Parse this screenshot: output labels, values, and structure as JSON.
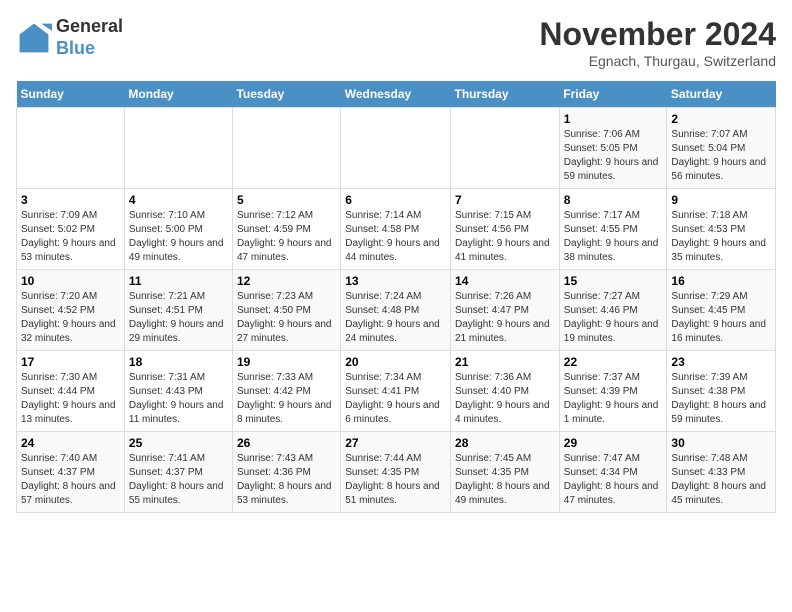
{
  "logo": {
    "text_general": "General",
    "text_blue": "Blue"
  },
  "title": "November 2024",
  "subtitle": "Egnach, Thurgau, Switzerland",
  "days_of_week": [
    "Sunday",
    "Monday",
    "Tuesday",
    "Wednesday",
    "Thursday",
    "Friday",
    "Saturday"
  ],
  "weeks": [
    [
      {
        "day": "",
        "info": ""
      },
      {
        "day": "",
        "info": ""
      },
      {
        "day": "",
        "info": ""
      },
      {
        "day": "",
        "info": ""
      },
      {
        "day": "",
        "info": ""
      },
      {
        "day": "1",
        "info": "Sunrise: 7:06 AM\nSunset: 5:05 PM\nDaylight: 9 hours and 59 minutes."
      },
      {
        "day": "2",
        "info": "Sunrise: 7:07 AM\nSunset: 5:04 PM\nDaylight: 9 hours and 56 minutes."
      }
    ],
    [
      {
        "day": "3",
        "info": "Sunrise: 7:09 AM\nSunset: 5:02 PM\nDaylight: 9 hours and 53 minutes."
      },
      {
        "day": "4",
        "info": "Sunrise: 7:10 AM\nSunset: 5:00 PM\nDaylight: 9 hours and 49 minutes."
      },
      {
        "day": "5",
        "info": "Sunrise: 7:12 AM\nSunset: 4:59 PM\nDaylight: 9 hours and 47 minutes."
      },
      {
        "day": "6",
        "info": "Sunrise: 7:14 AM\nSunset: 4:58 PM\nDaylight: 9 hours and 44 minutes."
      },
      {
        "day": "7",
        "info": "Sunrise: 7:15 AM\nSunset: 4:56 PM\nDaylight: 9 hours and 41 minutes."
      },
      {
        "day": "8",
        "info": "Sunrise: 7:17 AM\nSunset: 4:55 PM\nDaylight: 9 hours and 38 minutes."
      },
      {
        "day": "9",
        "info": "Sunrise: 7:18 AM\nSunset: 4:53 PM\nDaylight: 9 hours and 35 minutes."
      }
    ],
    [
      {
        "day": "10",
        "info": "Sunrise: 7:20 AM\nSunset: 4:52 PM\nDaylight: 9 hours and 32 minutes."
      },
      {
        "day": "11",
        "info": "Sunrise: 7:21 AM\nSunset: 4:51 PM\nDaylight: 9 hours and 29 minutes."
      },
      {
        "day": "12",
        "info": "Sunrise: 7:23 AM\nSunset: 4:50 PM\nDaylight: 9 hours and 27 minutes."
      },
      {
        "day": "13",
        "info": "Sunrise: 7:24 AM\nSunset: 4:48 PM\nDaylight: 9 hours and 24 minutes."
      },
      {
        "day": "14",
        "info": "Sunrise: 7:26 AM\nSunset: 4:47 PM\nDaylight: 9 hours and 21 minutes."
      },
      {
        "day": "15",
        "info": "Sunrise: 7:27 AM\nSunset: 4:46 PM\nDaylight: 9 hours and 19 minutes."
      },
      {
        "day": "16",
        "info": "Sunrise: 7:29 AM\nSunset: 4:45 PM\nDaylight: 9 hours and 16 minutes."
      }
    ],
    [
      {
        "day": "17",
        "info": "Sunrise: 7:30 AM\nSunset: 4:44 PM\nDaylight: 9 hours and 13 minutes."
      },
      {
        "day": "18",
        "info": "Sunrise: 7:31 AM\nSunset: 4:43 PM\nDaylight: 9 hours and 11 minutes."
      },
      {
        "day": "19",
        "info": "Sunrise: 7:33 AM\nSunset: 4:42 PM\nDaylight: 9 hours and 8 minutes."
      },
      {
        "day": "20",
        "info": "Sunrise: 7:34 AM\nSunset: 4:41 PM\nDaylight: 9 hours and 6 minutes."
      },
      {
        "day": "21",
        "info": "Sunrise: 7:36 AM\nSunset: 4:40 PM\nDaylight: 9 hours and 4 minutes."
      },
      {
        "day": "22",
        "info": "Sunrise: 7:37 AM\nSunset: 4:39 PM\nDaylight: 9 hours and 1 minute."
      },
      {
        "day": "23",
        "info": "Sunrise: 7:39 AM\nSunset: 4:38 PM\nDaylight: 8 hours and 59 minutes."
      }
    ],
    [
      {
        "day": "24",
        "info": "Sunrise: 7:40 AM\nSunset: 4:37 PM\nDaylight: 8 hours and 57 minutes."
      },
      {
        "day": "25",
        "info": "Sunrise: 7:41 AM\nSunset: 4:37 PM\nDaylight: 8 hours and 55 minutes."
      },
      {
        "day": "26",
        "info": "Sunrise: 7:43 AM\nSunset: 4:36 PM\nDaylight: 8 hours and 53 minutes."
      },
      {
        "day": "27",
        "info": "Sunrise: 7:44 AM\nSunset: 4:35 PM\nDaylight: 8 hours and 51 minutes."
      },
      {
        "day": "28",
        "info": "Sunrise: 7:45 AM\nSunset: 4:35 PM\nDaylight: 8 hours and 49 minutes."
      },
      {
        "day": "29",
        "info": "Sunrise: 7:47 AM\nSunset: 4:34 PM\nDaylight: 8 hours and 47 minutes."
      },
      {
        "day": "30",
        "info": "Sunrise: 7:48 AM\nSunset: 4:33 PM\nDaylight: 8 hours and 45 minutes."
      }
    ]
  ]
}
